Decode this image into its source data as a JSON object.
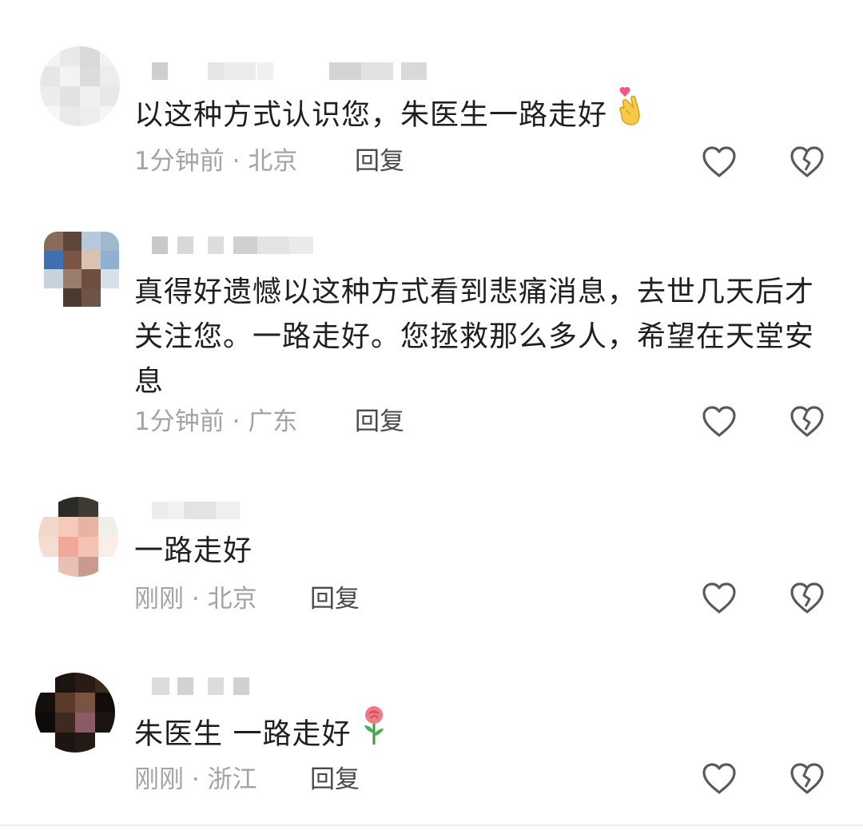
{
  "comments": [
    {
      "content": "以这种方式认识您，朱医生一路走好",
      "emoji": "finger-heart-emoji",
      "time": "1分钟前",
      "location": "北京",
      "reply_label": "回复",
      "like_icon": "heart-outline-icon",
      "dislike_icon": "broken-heart-outline-icon"
    },
    {
      "content": "真得好遗憾以这种方式看到悲痛消息，去世几天后才关注您。一路走好。您拯救那么多人，希望在天堂安息",
      "time": "1分钟前",
      "location": "广东",
      "reply_label": "回复",
      "like_icon": "heart-outline-icon",
      "dislike_icon": "broken-heart-outline-icon"
    },
    {
      "content": "一路走好",
      "time": "刚刚",
      "location": "北京",
      "reply_label": "回复",
      "like_icon": "heart-outline-icon",
      "dislike_icon": "broken-heart-outline-icon"
    },
    {
      "content": "朱医生 一路走好",
      "emoji": "rose-emoji",
      "time": "刚刚",
      "location": "浙江",
      "reply_label": "回复",
      "like_icon": "heart-outline-icon",
      "dislike_icon": "broken-heart-outline-icon"
    }
  ],
  "meta_separator": "·",
  "colors": {
    "text": "#1f1f1f",
    "meta": "#a3a3a3",
    "reply": "#4b4b4b",
    "icon": "#5a5a5a"
  }
}
